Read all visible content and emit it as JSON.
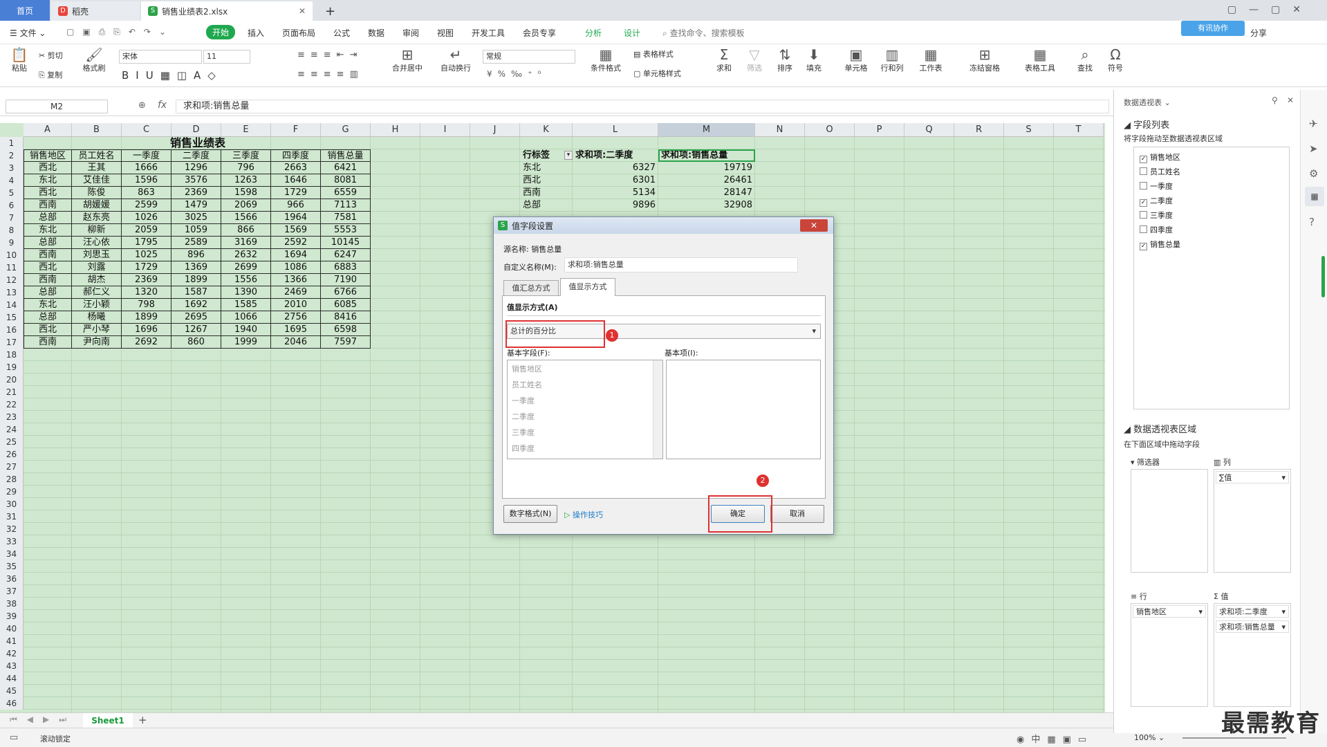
{
  "tabs": {
    "home": "首页",
    "daoke": "稻壳",
    "file": "销售业绩表2.xlsx"
  },
  "menu": {
    "file": "文件",
    "start": "开始",
    "insert": "插入",
    "layout": "页面布局",
    "formula": "公式",
    "data": "数据",
    "review": "审阅",
    "view": "视图",
    "dev": "开发工具",
    "member": "会员专享",
    "analyze": "分析",
    "design": "设计",
    "search": "查找命令、搜索模板",
    "collab": "有讯协作",
    "share": "分享"
  },
  "ribbon": {
    "paste": "粘贴",
    "cut": "剪切",
    "copy": "复制",
    "brush": "格式刷",
    "font": "宋体",
    "size": "11",
    "merge": "合并居中",
    "wrap": "自动换行",
    "numfmt": "常规",
    "condfmt": "条件格式",
    "tablestyle": "表格样式",
    "cellstyle": "单元格样式",
    "sum": "求和",
    "filter": "筛选",
    "sort": "排序",
    "fill": "填充",
    "cell": "单元格",
    "rowcol": "行和列",
    "sheet": "工作表",
    "freeze": "冻结窗格",
    "tools": "表格工具",
    "find": "查找",
    "symbol": "符号"
  },
  "formula_bar": {
    "cell_ref": "M2",
    "fx": "fx",
    "content": "求和项:销售总量"
  },
  "columns": [
    "A",
    "B",
    "C",
    "D",
    "E",
    "F",
    "G",
    "H",
    "I",
    "J",
    "K",
    "L",
    "M",
    "N",
    "O",
    "P",
    "Q",
    "R",
    "S",
    "T"
  ],
  "sheet_title": "销售业绩表",
  "table_headers": [
    "销售地区",
    "员工姓名",
    "一季度",
    "二季度",
    "三季度",
    "四季度",
    "销售总量"
  ],
  "table_rows": [
    [
      "西北",
      "王其",
      "1666",
      "1296",
      "796",
      "2663",
      "6421"
    ],
    [
      "东北",
      "艾佳佳",
      "1596",
      "3576",
      "1263",
      "1646",
      "8081"
    ],
    [
      "西北",
      "陈俊",
      "863",
      "2369",
      "1598",
      "1729",
      "6559"
    ],
    [
      "西南",
      "胡媛媛",
      "2599",
      "1479",
      "2069",
      "966",
      "7113"
    ],
    [
      "总部",
      "赵东亮",
      "1026",
      "3025",
      "1566",
      "1964",
      "7581"
    ],
    [
      "东北",
      "柳新",
      "2059",
      "1059",
      "866",
      "1569",
      "5553"
    ],
    [
      "总部",
      "汪心依",
      "1795",
      "2589",
      "3169",
      "2592",
      "10145"
    ],
    [
      "西南",
      "刘思玉",
      "1025",
      "896",
      "2632",
      "1694",
      "6247"
    ],
    [
      "西北",
      "刘露",
      "1729",
      "1369",
      "2699",
      "1086",
      "6883"
    ],
    [
      "西南",
      "胡杰",
      "2369",
      "1899",
      "1556",
      "1366",
      "7190"
    ],
    [
      "总部",
      "郝仁义",
      "1320",
      "1587",
      "1390",
      "2469",
      "6766"
    ],
    [
      "东北",
      "汪小颖",
      "798",
      "1692",
      "1585",
      "2010",
      "6085"
    ],
    [
      "总部",
      "杨曦",
      "1899",
      "2695",
      "1066",
      "2756",
      "8416"
    ],
    [
      "西北",
      "严小琴",
      "1696",
      "1267",
      "1940",
      "1695",
      "6598"
    ],
    [
      "西南",
      "尹向南",
      "2692",
      "860",
      "1999",
      "2046",
      "7597"
    ]
  ],
  "pivot": {
    "headers": [
      "行标签",
      "求和项:二季度",
      "求和项:销售总量"
    ],
    "rows": [
      [
        "东北",
        "6327",
        "19719"
      ],
      [
        "西北",
        "6301",
        "26461"
      ],
      [
        "西南",
        "5134",
        "28147"
      ],
      [
        "总部",
        "9896",
        "32908"
      ]
    ]
  },
  "dialog": {
    "title": "值字段设置",
    "source_label": "源名称:",
    "source_value": "销售总量",
    "custom_label": "自定义名称(M):",
    "custom_value": "求和项:销售总量",
    "tab1": "值汇总方式",
    "tab2": "值显示方式",
    "show_as_label": "值显示方式(A)",
    "show_as_value": "总计的百分比",
    "base_field_label": "基本字段(F):",
    "base_item_label": "基本项(I):",
    "base_fields": [
      "销售地区",
      "员工姓名",
      "一季度",
      "二季度",
      "三季度",
      "四季度"
    ],
    "numfmt_btn": "数字格式(N)",
    "tips": "操作技巧",
    "ok": "确定",
    "cancel": "取消",
    "badge1": "1",
    "badge2": "2"
  },
  "panel": {
    "title": "数据透视表",
    "field_list": "字段列表",
    "field_hint": "将字段拖动至数据透视表区域",
    "fields": [
      {
        "label": "销售地区",
        "checked": true
      },
      {
        "label": "员工姓名",
        "checked": false
      },
      {
        "label": "一季度",
        "checked": false
      },
      {
        "label": "二季度",
        "checked": true
      },
      {
        "label": "三季度",
        "checked": false
      },
      {
        "label": "四季度",
        "checked": false
      },
      {
        "label": "销售总量",
        "checked": true
      }
    ],
    "area_title": "数据透视表区域",
    "area_hint": "在下面区域中拖动字段",
    "filter": "筛选器",
    "column": "列",
    "row": "行",
    "value": "值",
    "col_item": "∑值",
    "row_item": "销售地区",
    "value_items": [
      "求和项:二季度",
      "求和项:销售总量"
    ]
  },
  "sheet_tab": "Sheet1",
  "status": {
    "scroll_lock": "滚动锁定",
    "zoom": "100%"
  },
  "watermark": "最需教育"
}
